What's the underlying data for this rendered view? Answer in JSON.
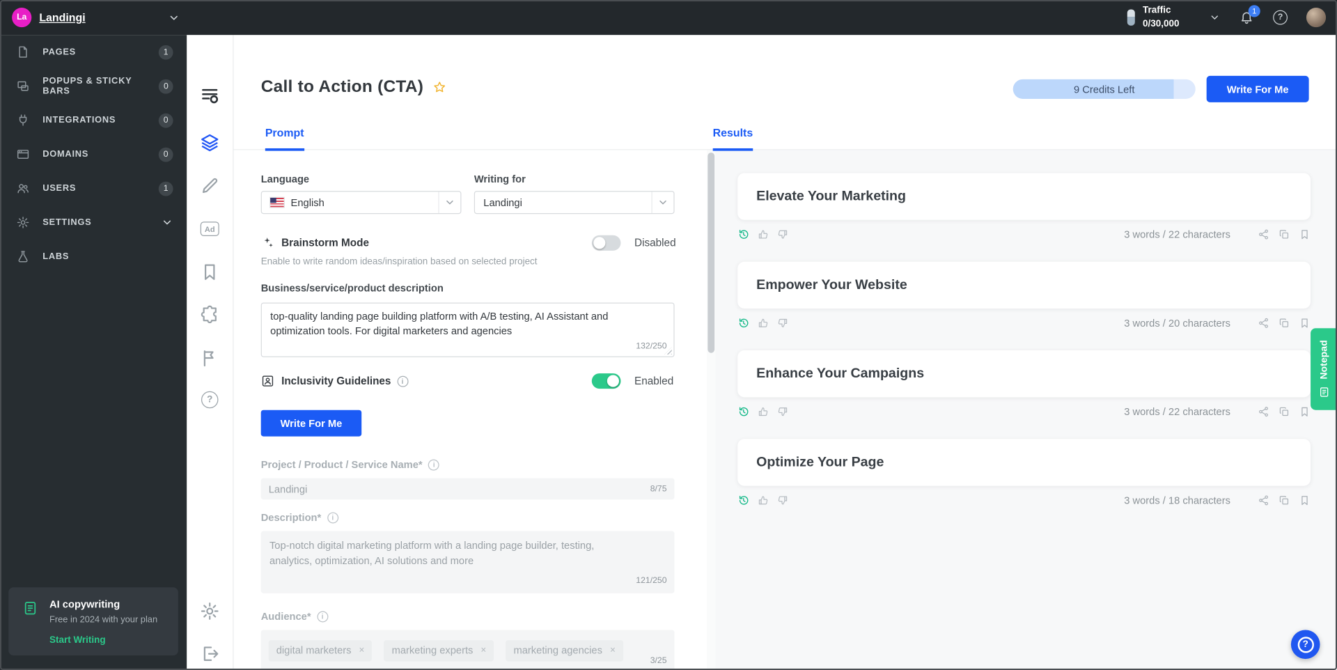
{
  "colors": {
    "accent_blue": "#1b5bf5",
    "brand_magenta": "#e81fc6",
    "green": "#2bc98a",
    "topbar_bg": "#23282c",
    "sidebar_bg": "#272d31",
    "results_bg": "#f7f8f9",
    "credits_pill_bg": "#bcd7fb"
  },
  "topbar": {
    "logo_initials": "La",
    "brand": "Landingi",
    "traffic_label": "Traffic",
    "traffic_value": "0/30,000",
    "notification_count": "1",
    "help_glyph": "?"
  },
  "sidebar": {
    "items": [
      {
        "label": "PAGES",
        "badge": "1"
      },
      {
        "label": "POPUPS & STICKY BARS",
        "badge": "0"
      },
      {
        "label": "INTEGRATIONS",
        "badge": "0"
      },
      {
        "label": "DOMAINS",
        "badge": "0"
      },
      {
        "label": "USERS",
        "badge": "1"
      },
      {
        "label": "SETTINGS",
        "badge": ""
      },
      {
        "label": "LABS",
        "badge": ""
      }
    ],
    "promo": {
      "title": "AI copywriting",
      "subtitle": "Free in 2024 with your plan",
      "cta": "Start Writing"
    }
  },
  "rail": {
    "ad_label": "Ad",
    "help_glyph": "?"
  },
  "header": {
    "title": "Call to Action (CTA)",
    "credits": "9 Credits Left",
    "write_button": "Write For Me"
  },
  "tabs": {
    "prompt": "Prompt",
    "results": "Results"
  },
  "prompt": {
    "language": {
      "label": "Language",
      "value": "English"
    },
    "writing_for": {
      "label": "Writing for",
      "value": "Landingi"
    },
    "brainstorm": {
      "label": "Brainstorm Mode",
      "state": "Disabled",
      "description": "Enable to write random ideas/inspiration based on selected project"
    },
    "business_description": {
      "label": "Business/service/product description",
      "value": "top-quality landing page building platform with A/B testing, AI Assistant and optimization tools. For digital marketers and agencies",
      "counter": "132/250"
    },
    "inclusivity": {
      "label": "Inclusivity Guidelines",
      "state": "Enabled",
      "info_glyph": "i"
    },
    "write_button": "Write For Me",
    "project_name": {
      "label": "Project / Product / Service Name*",
      "value": "Landingi",
      "counter": "8/75",
      "info_glyph": "i"
    },
    "description": {
      "label": "Description*",
      "value": "Top-notch digital marketing platform with a landing page builder, testing, analytics, optimization, AI solutions and more",
      "counter": "121/250",
      "info_glyph": "i"
    },
    "audience": {
      "label": "Audience*",
      "chips": [
        "digital marketers",
        "marketing experts",
        "marketing agencies"
      ],
      "chip_remove_glyph": "×",
      "counter": "3/25",
      "info_glyph": "i"
    }
  },
  "results": {
    "items": [
      {
        "title": "Elevate Your Marketing",
        "meta": "3 words / 22 characters"
      },
      {
        "title": "Empower Your Website",
        "meta": "3 words / 20 characters"
      },
      {
        "title": "Enhance Your Campaigns",
        "meta": "3 words / 22 characters"
      },
      {
        "title": "Optimize Your Page",
        "meta": "3 words / 18 characters"
      }
    ]
  },
  "notepad": {
    "label": "Notepad"
  },
  "fab": {
    "glyph": "?"
  }
}
